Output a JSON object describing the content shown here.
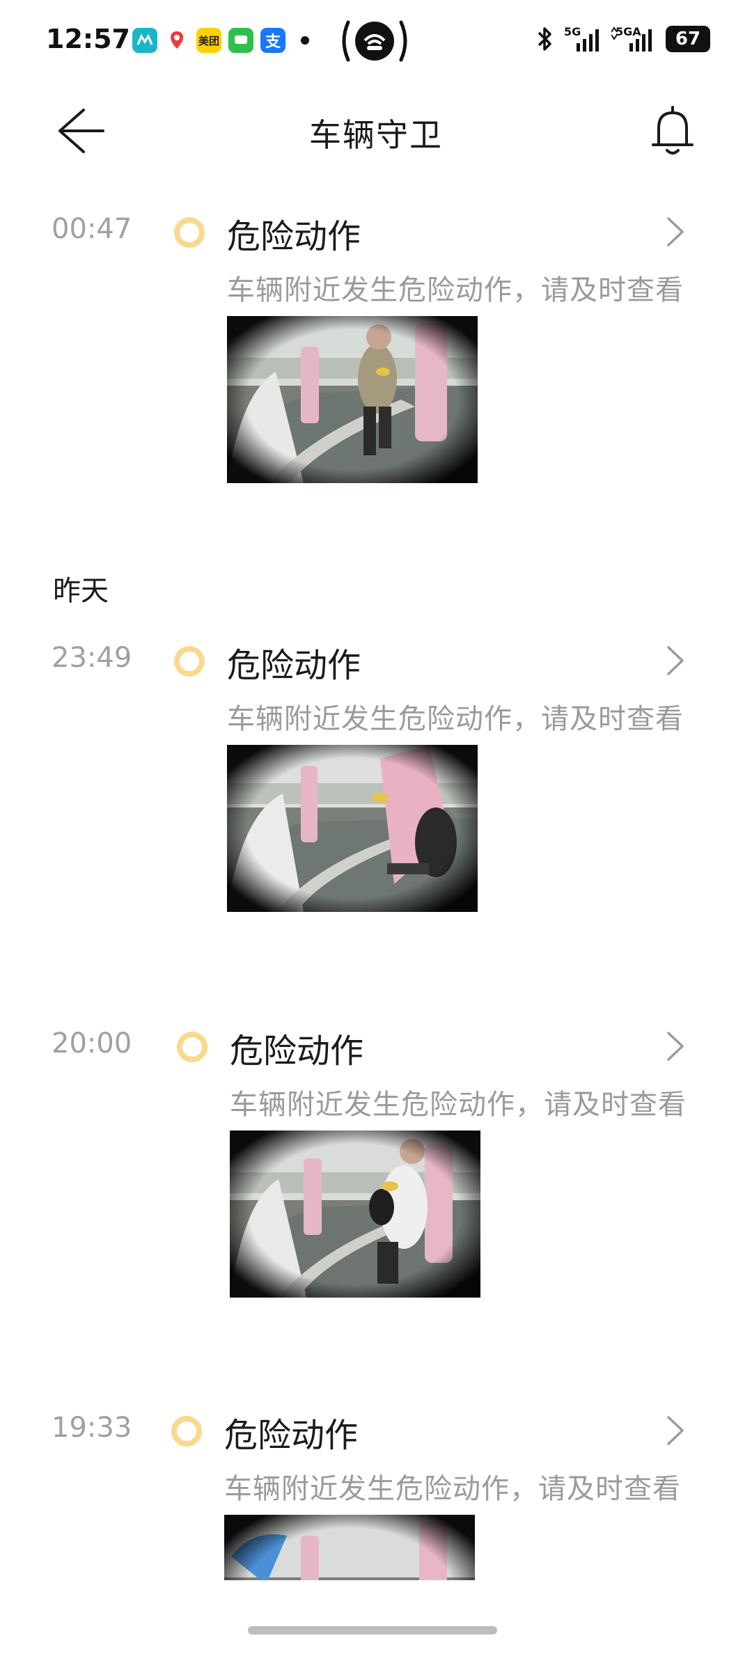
{
  "status_bar": {
    "time": "12:57",
    "apps": [
      {
        "icon": "nio-app-icon",
        "label": "",
        "color": "#19b6c9"
      },
      {
        "icon": "maps-pin-icon",
        "label": "",
        "color": "#ffffff"
      },
      {
        "icon": "meituan-icon",
        "label": "美团",
        "color": "#ffd100"
      },
      {
        "icon": "messages-icon",
        "label": "",
        "color": "#2fbf4b"
      },
      {
        "icon": "alipay-icon",
        "label": "支",
        "color": "#1677ff"
      }
    ],
    "network_1": "5G",
    "network_2": "5GA",
    "battery": "67"
  },
  "header": {
    "title": "车辆守卫"
  },
  "sections": {
    "yesterday_label": "昨天"
  },
  "events": [
    {
      "time": "00:47",
      "title": "危险动作",
      "description": "车辆附近发生危险动作，请及时查看",
      "thumbnail": "fisheye-parking-camera"
    },
    {
      "time": "23:49",
      "title": "危险动作",
      "description": "车辆附近发生危险动作，请及时查看",
      "thumbnail": "fisheye-parking-camera"
    },
    {
      "time": "20:00",
      "title": "危险动作",
      "description": "车辆附近发生危险动作，请及时查看",
      "thumbnail": "fisheye-parking-camera"
    },
    {
      "time": "19:33",
      "title": "危险动作",
      "description": "车辆附近发生危险动作，请及时查看",
      "thumbnail": "fisheye-parking-camera"
    }
  ],
  "colors": {
    "event_dot": "#fad98f",
    "secondary_text": "#9a9a9a",
    "time_text": "#a0a0a0"
  }
}
